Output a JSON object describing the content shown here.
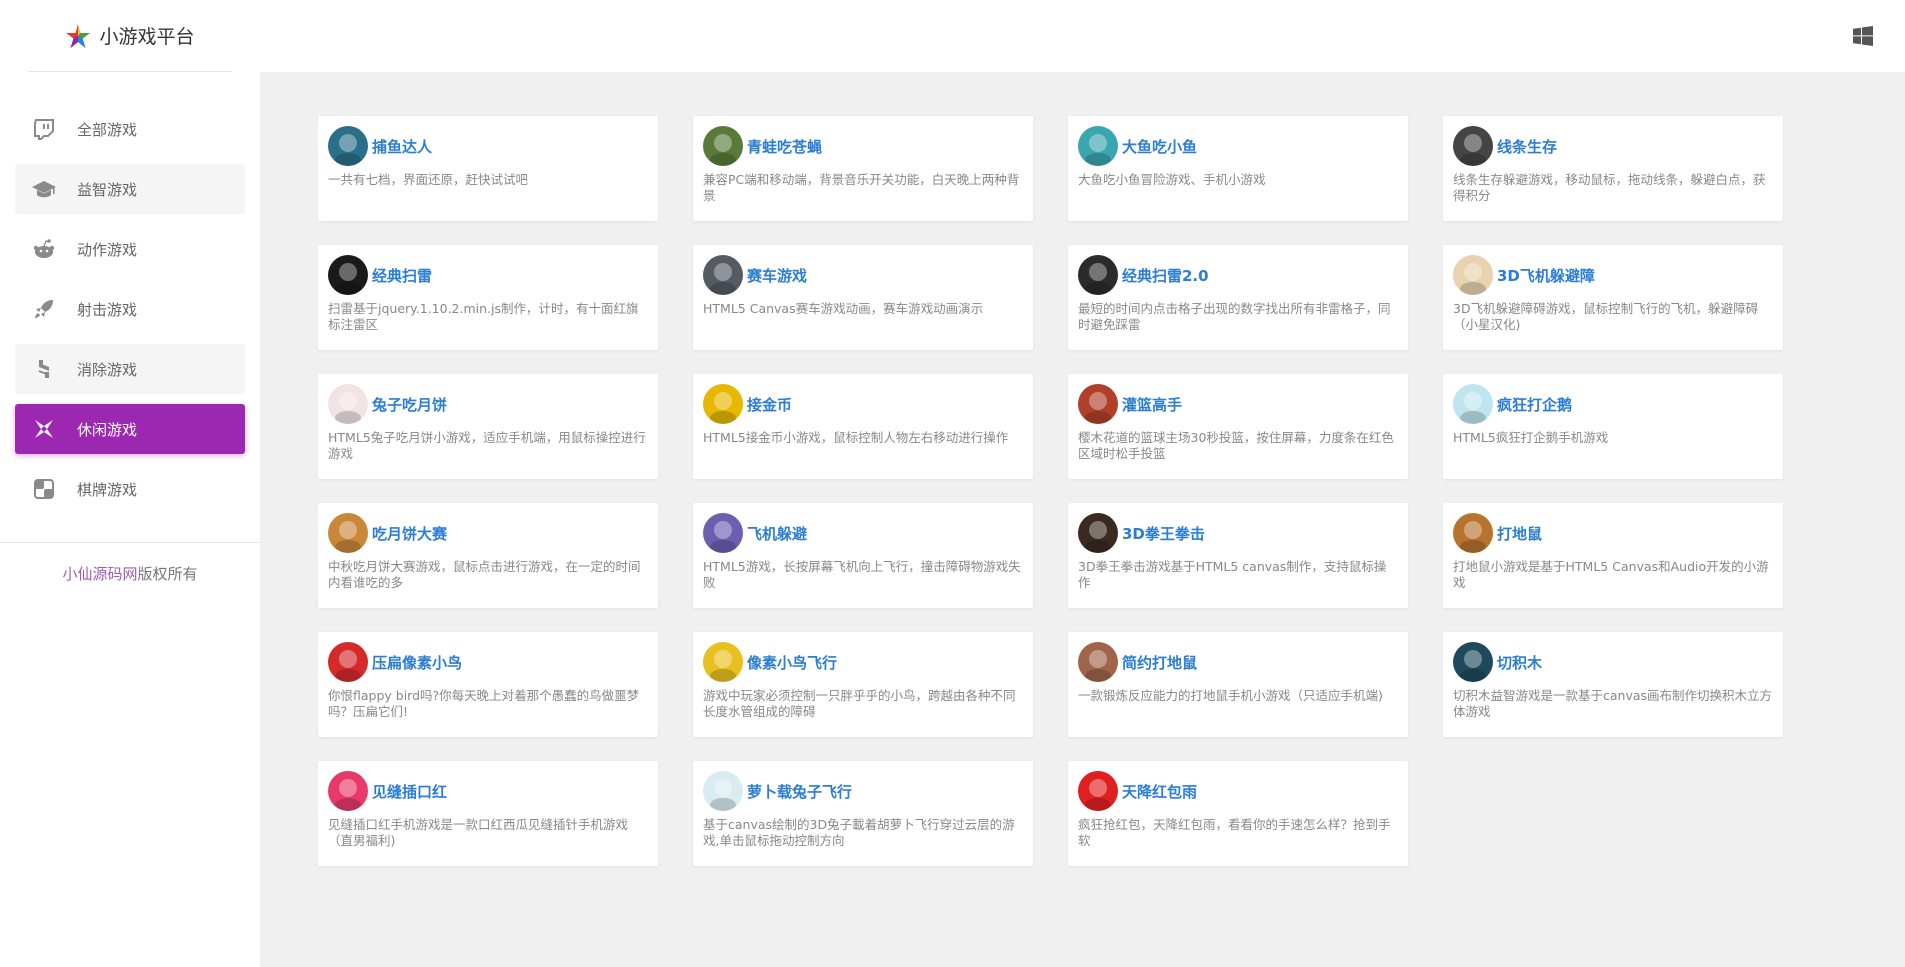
{
  "brand": {
    "name": "小游戏平台"
  },
  "nav": [
    {
      "label": "全部游戏",
      "icon": "twitch-icon"
    },
    {
      "label": "益智游戏",
      "icon": "graduation-cap-icon"
    },
    {
      "label": "动作游戏",
      "icon": "reddit-icon"
    },
    {
      "label": "射击游戏",
      "icon": "rocket-icon"
    },
    {
      "label": "消除游戏",
      "icon": "hubspot-icon"
    },
    {
      "label": "休闲游戏",
      "icon": "pinwheel-icon"
    },
    {
      "label": "棋牌游戏",
      "icon": "chess-board-icon"
    }
  ],
  "active_nav": "休闲游戏",
  "copyright": {
    "link": "小仙源码网",
    "suffix": "版权所有"
  },
  "accent_color": "#9c27b0",
  "title_color": "#2b7ed4",
  "games": [
    {
      "title": "捕鱼达人",
      "desc": "一共有七档，界面还原，赶快试试吧",
      "icon": "fish-catcher-icon",
      "color": "#2a6f8a"
    },
    {
      "title": "青蛙吃苍蝇",
      "desc": "兼容PC端和移动端，背景音乐开关功能，白天晚上两种背景",
      "icon": "frog-icon",
      "color": "#5a7a3a"
    },
    {
      "title": "大鱼吃小鱼",
      "desc": "大鱼吃小鱼冒险游戏、手机小游戏",
      "icon": "shark-icon",
      "color": "#3aa6b0"
    },
    {
      "title": "线条生存",
      "desc": "线条生存躲避游戏，移动鼠标，拖动线条，躲避白点，获得积分",
      "icon": "dots-icon",
      "color": "#444444"
    },
    {
      "title": "经典扫雷",
      "desc": "扫雷基于jquery.1.10.2.min.js制作，计时，有十面红旗标注雷区",
      "icon": "bomb-icon",
      "color": "#1a1a1a"
    },
    {
      "title": "赛车游戏",
      "desc": "HTML5 Canvas赛车游戏动画，赛车游戏动画演示",
      "icon": "race-car-icon",
      "color": "#555a63"
    },
    {
      "title": "经典扫雷2.0",
      "desc": "最短的时间内点击格子出现的数字找出所有非雷格子，同时避免踩雷",
      "icon": "minesweeper-grid-icon",
      "color": "#2b2b2b"
    },
    {
      "title": "3D飞机躲避障",
      "desc": "3D飞机躲避障碍游戏，鼠标控制飞行的飞机，躲避障碍（小星汉化)",
      "icon": "plane-icon",
      "color": "#e8d2b0"
    },
    {
      "title": "兔子吃月饼",
      "desc": "HTML5兔子吃月饼小游戏，适应手机端，用鼠标操控进行游戏",
      "icon": "rabbit-icon",
      "color": "#f2e4e4"
    },
    {
      "title": "接金币",
      "desc": "HTML5接金币小游戏，鼠标控制人物左右移动进行操作",
      "icon": "coin-icon",
      "color": "#e6b800"
    },
    {
      "title": "灌篮高手",
      "desc": "樱木花道的篮球主场30秒投篮，按住屏幕，力度条在红色区域时松手投篮",
      "icon": "basketball-player-icon",
      "color": "#b0402a"
    },
    {
      "title": "疯狂打企鹅",
      "desc": "HTML5疯狂打企鹅手机游戏",
      "icon": "penguin-icon",
      "color": "#bfe6ef"
    },
    {
      "title": "吃月饼大赛",
      "desc": "中秋吃月饼大赛游戏，鼠标点击进行游戏，在一定的时间内看谁吃的多",
      "icon": "mooncake-icon",
      "color": "#c9873a"
    },
    {
      "title": "飞机躲避",
      "desc": "HTML5游戏，长按屏幕飞机向上飞行，撞击障碍物游戏失败",
      "icon": "jet-icon",
      "color": "#6c5fb0"
    },
    {
      "title": "3D拳王拳击",
      "desc": "3D拳王拳击游戏基于HTML5 canvas制作，支持鼠标操作",
      "icon": "boxer-icon",
      "color": "#3a2a22"
    },
    {
      "title": "打地鼠",
      "desc": "打地鼠小游戏是基于HTML5 Canvas和Audio开发的小游戏",
      "icon": "hammer-icon",
      "color": "#b8732e"
    },
    {
      "title": "压扁像素小鸟",
      "desc": "你恨flappy bird吗?你每天晚上对着那个愚蠢的鸟做噩梦吗？压扁它们!",
      "icon": "red-bird-icon",
      "color": "#d42a2a"
    },
    {
      "title": "像素小鸟飞行",
      "desc": "游戏中玩家必须控制一只胖乎乎的小鸟，跨越由各种不同长度水管组成的障碍",
      "icon": "flappy-bird-icon",
      "color": "#e8c020"
    },
    {
      "title": "简约打地鼠",
      "desc": "一款锻炼反应能力的打地鼠手机小游戏（只适应手机端)",
      "icon": "mole-icon",
      "color": "#a0644a"
    },
    {
      "title": "切积木",
      "desc": "切积木益智游戏是一款基于canvas画布制作切换积木立方体游戏",
      "icon": "block-icon",
      "color": "#1f4a5c"
    },
    {
      "title": "见缝插口红",
      "desc": "见缝插口红手机游戏是一款口红西瓜见缝插针手机游戏（直男福利)",
      "icon": "lipstick-icon",
      "color": "#e83a6a"
    },
    {
      "title": "萝卜载兔子飞行",
      "desc": "基于canvas绘制的3D兔子載着胡萝卜飞行穿过云层的游戏,单击鼠标拖动控制方向",
      "icon": "bunny-icon",
      "color": "#d8ecf2"
    },
    {
      "title": "天降红包雨",
      "desc": "疯狂抢红包，天降红包雨，看看你的手速怎么样？抢到手软",
      "icon": "red-envelope-icon",
      "color": "#e02020"
    }
  ]
}
